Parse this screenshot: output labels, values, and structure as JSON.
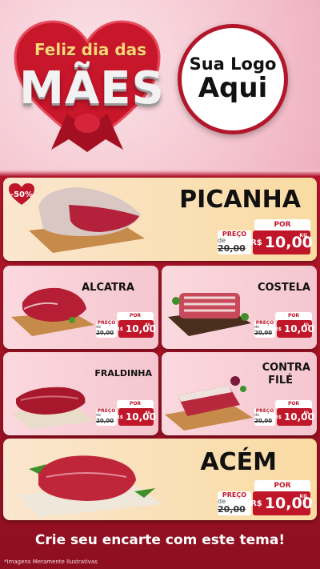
{
  "header": {
    "greeting": "Feliz dia das",
    "title": "MÃES",
    "logo_line1": "Sua Logo",
    "logo_line2": "Aqui"
  },
  "colors": {
    "accent": "#c0162a",
    "gold": "#ffd77a",
    "card": "#f9dba2"
  },
  "products": [
    {
      "name": "PICANHA",
      "badge": "-50%",
      "por": "POR",
      "preco": "PREÇO",
      "de": "de",
      "old": "20,00",
      "currency": "R$",
      "price": "10,00",
      "unit": "KG"
    },
    {
      "name": "ALCATRA",
      "por": "POR",
      "preco": "PREÇO",
      "de": "de",
      "old": "20,00",
      "currency": "R$",
      "price": "10,00",
      "unit": "KG"
    },
    {
      "name": "COSTELA",
      "por": "POR",
      "preco": "PREÇO",
      "de": "de",
      "old": "20,00",
      "currency": "R$",
      "price": "10,00",
      "unit": "KG"
    },
    {
      "name": "FRALDINHA",
      "por": "POR",
      "preco": "PREÇO",
      "de": "de",
      "old": "20,00",
      "currency": "R$",
      "price": "10,00",
      "unit": "KG"
    },
    {
      "name_line1": "CONTRA",
      "name_line2": "FILÉ",
      "por": "POR",
      "preco": "PREÇO",
      "de": "de",
      "old": "20,00",
      "currency": "R$",
      "price": "10,00",
      "unit": "KG"
    },
    {
      "name": "ACÉM",
      "por": "POR",
      "preco": "PREÇO",
      "de": "de",
      "old": "20,00",
      "currency": "R$",
      "price": "10,00",
      "unit": "KG"
    }
  ],
  "footer": {
    "cta": "Crie seu encarte com este tema!",
    "disclaimer": "*Imagens Meramente Ilustrativas"
  }
}
